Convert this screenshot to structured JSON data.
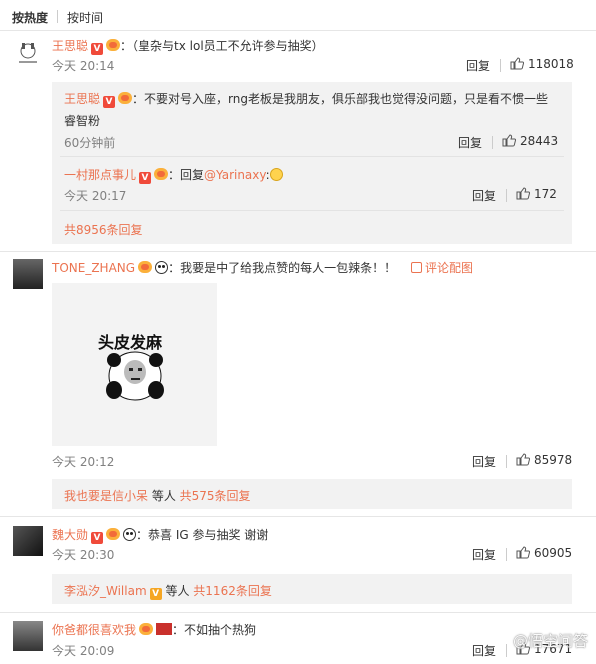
{
  "sort": {
    "hot": "按热度",
    "time": "按时间"
  },
  "reply_label": "回复",
  "comments": [
    {
      "user": "王思聪",
      "text": "：（皇杂与tx lol员工不允许参与抽奖）",
      "time": "今天 20:14",
      "likes": "118018",
      "subs": [
        {
          "user": "王思聪",
          "text_line1": "：不要对号入座，rng老板是我朋友，俱乐部我也觉得没问题，只是看不惯一些",
          "text_line2": "睿智粉",
          "time": "60分钟前",
          "likes": "28443"
        },
        {
          "user": "一村那点事儿",
          "text_prefix": "：回复",
          "mention": "@Yarinaxy",
          "text_suffix": ":",
          "time": "今天 20:17",
          "likes": "172"
        }
      ],
      "more": "共8956条回复"
    },
    {
      "user": "TONE_ZHANG",
      "text": "：我要是中了给我点赞的每人一包辣条！！",
      "report": "评论配图",
      "image_caption": "头皮发麻",
      "time": "今天 20:12",
      "likes": "85978",
      "summary_user": "我也要是信小呆",
      "summary_mid": " 等人 ",
      "summary_count": "共575条回复"
    },
    {
      "user": "魏大勋",
      "text": "：恭喜 IG 参与抽奖 谢谢",
      "time": "今天 20:30",
      "likes": "60905",
      "summary_user": "李泓汐_Willam",
      "summary_mid": " 等人 ",
      "summary_count": "共1162条回复"
    },
    {
      "user": "你爸都很喜欢我",
      "text": "：不如抽个热狗",
      "time": "今天 20:09",
      "likes": "17671"
    }
  ],
  "watermark": "@悟空问答",
  "colors": {
    "accent": "#eb7350",
    "bg_sub": "#f2f2f2"
  }
}
